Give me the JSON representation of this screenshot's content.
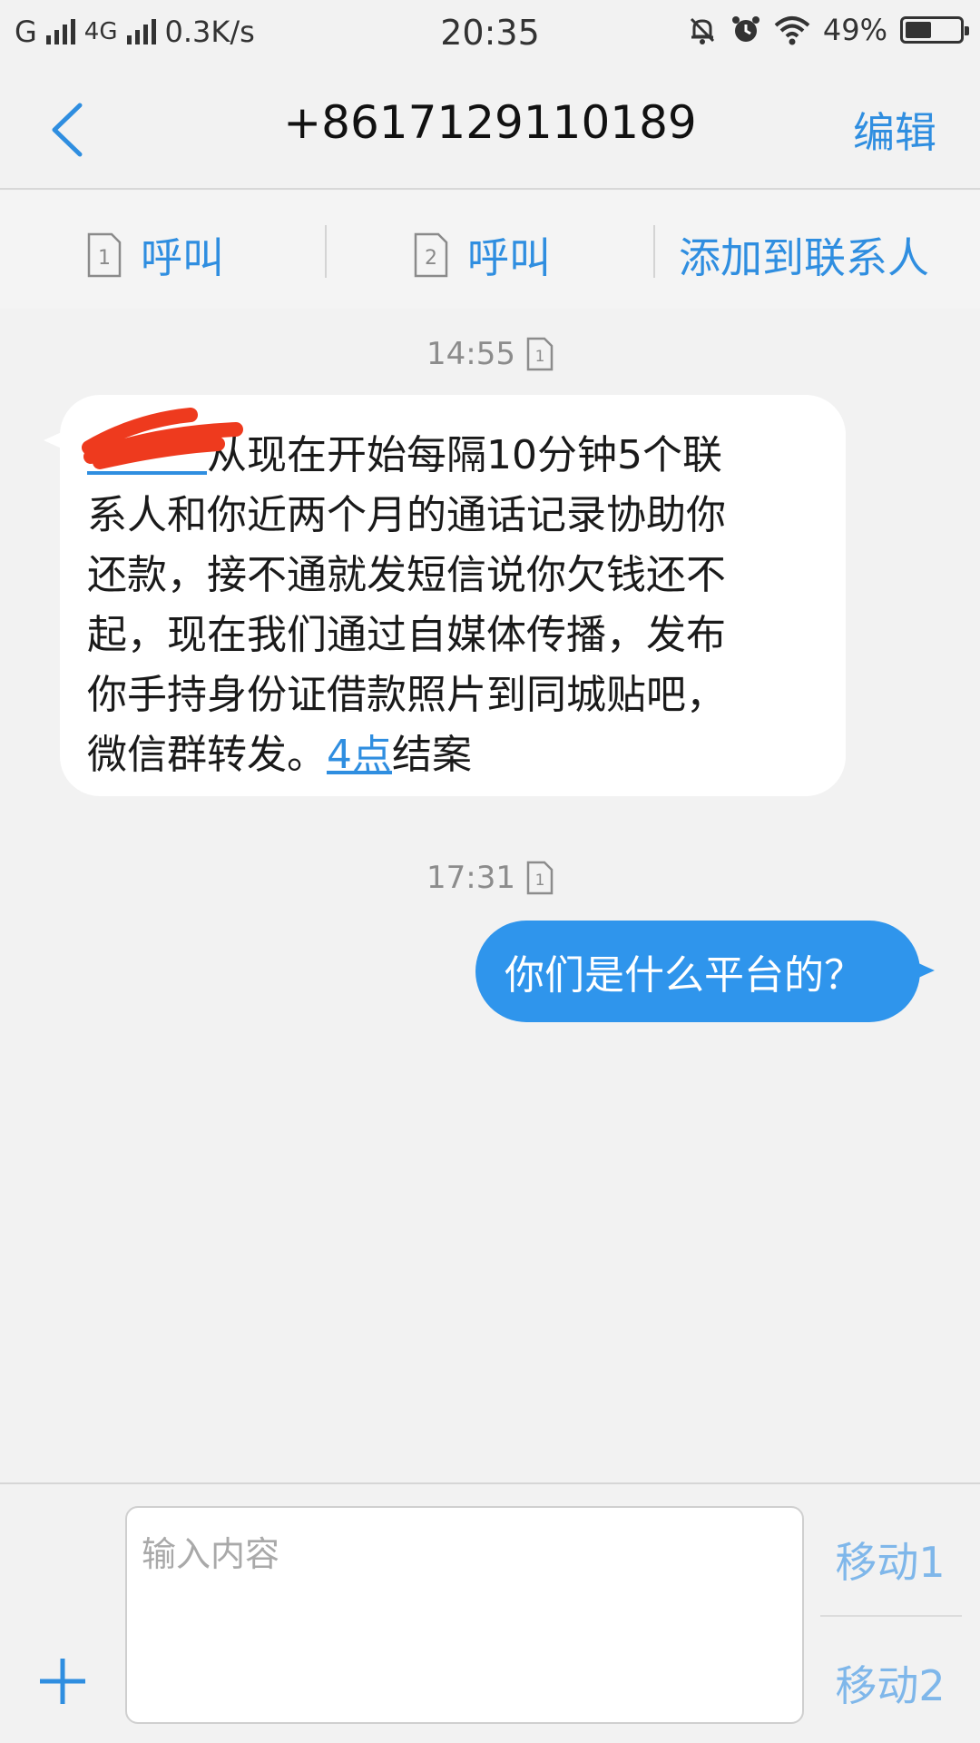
{
  "status_bar": {
    "carrier1": "G",
    "carrier2": "4G",
    "speed": "0.3K/s",
    "time": "20:35",
    "battery": "49%"
  },
  "header": {
    "title": "+8617129110189",
    "edit_label": "编辑"
  },
  "actions": {
    "call1_label": "呼叫",
    "call1_sim": "1",
    "call2_label": "呼叫",
    "call2_sim": "2",
    "add_contact_label": "添加到联系人"
  },
  "messages": [
    {
      "time": "14:55",
      "sim": "1",
      "direction": "incoming",
      "lines": [
        "从现在开始每隔10分钟5个联",
        "系人和你近两个月的通话记录协助你",
        "还款，接不通就发短信说你欠钱还不",
        "起，现在我们通过自媒体传播，发布",
        "你手持身份证借款照片到同城贴吧，"
      ],
      "last_line_prefix": "微信群转发。",
      "link": "4点",
      "last_line_suffix": "结案"
    },
    {
      "time": "17:31",
      "sim": "1",
      "direction": "outgoing",
      "text": "你们是什么平台的？"
    }
  ],
  "composer": {
    "placeholder": "输入内容",
    "send1_label": "移动1",
    "send2_label": "移动2"
  },
  "colors": {
    "accent": "#2f8ee0",
    "outgoing_bubble": "#2f95ec",
    "background": "#f2f2f2"
  }
}
